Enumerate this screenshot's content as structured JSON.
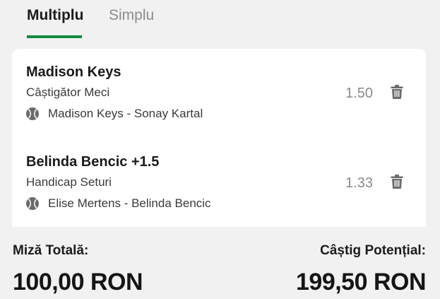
{
  "tabs": {
    "multiplu": "Multiplu",
    "simplu": "Simplu",
    "active": "multiplu"
  },
  "selections": [
    {
      "title": "Madison Keys",
      "market": "Câștigător Meci",
      "event": "Madison Keys - Sonay Kartal",
      "odds": "1.50",
      "sport_icon": "tennis-ball-icon",
      "delete_icon": "trash-icon"
    },
    {
      "title": "Belinda Bencic +1.5",
      "market": "Handicap Seturi",
      "event": "Elise Mertens - Belinda Bencic",
      "odds": "1.33",
      "sport_icon": "tennis-ball-icon",
      "delete_icon": "trash-icon"
    }
  ],
  "summary": {
    "stake_label": "Miză Totală:",
    "stake_value": "100,00 RON",
    "win_label": "Câștig Potențial:",
    "win_value": "199,50 RON"
  },
  "colors": {
    "accent": "#138a3f",
    "background": "#f1f1f1",
    "card": "#ffffff",
    "inactive_tab": "#8c8c8c"
  }
}
